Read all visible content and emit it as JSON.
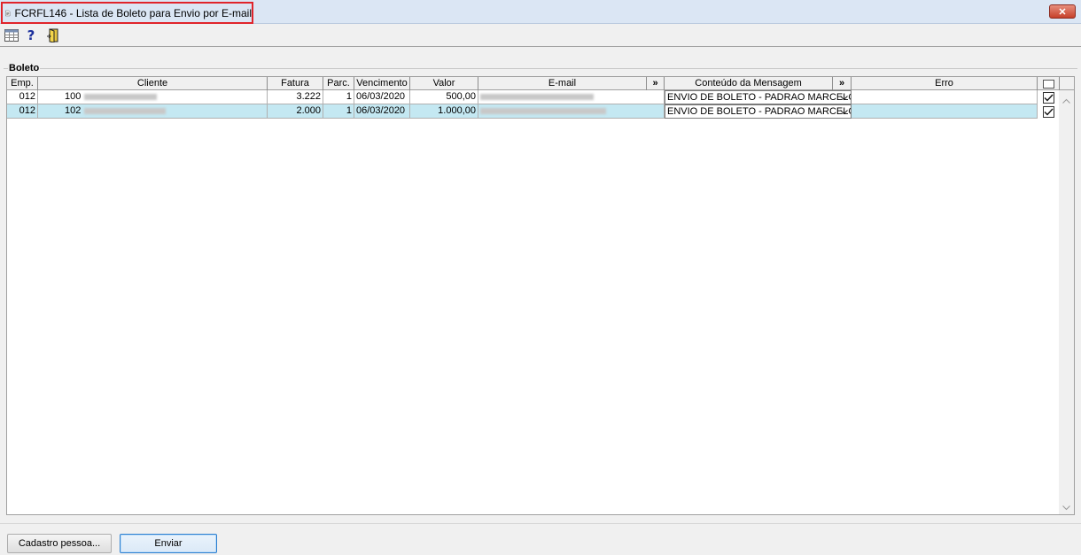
{
  "window": {
    "title": "FCRFL146 - Lista de Boleto para Envio por E-mail",
    "close_label": "✕"
  },
  "toolbar": {
    "icons": [
      "grid-icon",
      "help-icon",
      "exit-door-icon"
    ],
    "help_glyph": "?"
  },
  "group": {
    "label": "Boleto"
  },
  "table": {
    "columns": {
      "emp": "Emp.",
      "cliente": "Cliente",
      "fatura": "Fatura",
      "parc": "Parc.",
      "vencimento": "Vencimento",
      "valor": "Valor",
      "email": "E-mail",
      "expand1": "»",
      "conteudo": "Conteúdo da Mensagem",
      "expand2": "»",
      "erro": "Erro"
    },
    "rows": [
      {
        "emp": "012",
        "cliente_code": "100",
        "fatura": "3.222",
        "parc": "1",
        "vencimento": "06/03/2020",
        "valor": "500,00",
        "conteudo": "ENVIO DE BOLETO - PADRAO MARCELO",
        "erro": "",
        "checked": true,
        "selected": false
      },
      {
        "emp": "012",
        "cliente_code": "102",
        "fatura": "2.000",
        "parc": "1",
        "vencimento": "06/03/2020",
        "valor": "1.000,00",
        "conteudo": "ENVIO DE BOLETO - PADRAO MARCELO",
        "erro": "",
        "checked": true,
        "selected": true
      }
    ]
  },
  "buttons": {
    "cadastro": "Cadastro pessoa...",
    "enviar": "Enviar"
  },
  "colors": {
    "selected_row": "#c4e8f2",
    "title_highlight": "#e0242b",
    "close_button": "#c6402a"
  }
}
